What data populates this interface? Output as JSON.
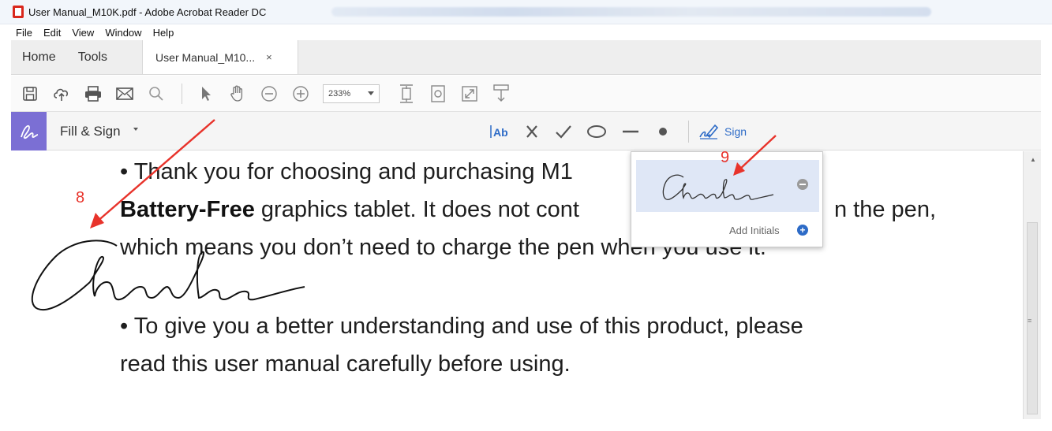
{
  "window": {
    "title": "User Manual_M10K.pdf - Adobe Acrobat Reader DC"
  },
  "menu": [
    "File",
    "Edit",
    "View",
    "Window",
    "Help"
  ],
  "tabs": {
    "home": "Home",
    "tools": "Tools",
    "document": "User Manual_M10...",
    "close": "×"
  },
  "toolbar": {
    "icons": [
      "save-icon",
      "cloud-upload-icon",
      "print-icon",
      "email-icon",
      "search-icon",
      "select-arrow-icon",
      "hand-icon",
      "zoom-out-icon",
      "zoom-in-icon",
      "fit-page-icon",
      "rotate-icon",
      "full-screen-icon",
      "comment-stamp-icon"
    ],
    "zoom_value": "233%"
  },
  "fill_sign": {
    "label": "Fill & Sign",
    "tools": [
      "text-tool-icon",
      "cross-mark-icon",
      "check-mark-icon",
      "circle-tool-icon",
      "line-tool-icon",
      "dot-tool-icon"
    ],
    "text_tool_label": "Ab",
    "sign_label": "Sign"
  },
  "document": {
    "line1_bullet": "•",
    "line1": "Thank you for choosing and purchasing M1",
    "line2_bold": "Battery-Free",
    "line2": "graphics tablet. It does not cont",
    "line2_tail": "n the pen,",
    "line3": "which means you don’t need to charge the pen when you use it.",
    "line4_bullet": "•",
    "line4": "To give you a better understanding and use of this product, please",
    "line5": "read this user manual carefully before using."
  },
  "signature_popup": {
    "add_initials": "Add Initials",
    "add_icon": "+"
  },
  "annotations": {
    "step8": "8",
    "step9": "9"
  },
  "colors": {
    "sign_mode_accent": "#7b6fd4",
    "link_blue": "#2d6bc7",
    "annotation_red": "#e8332b"
  }
}
